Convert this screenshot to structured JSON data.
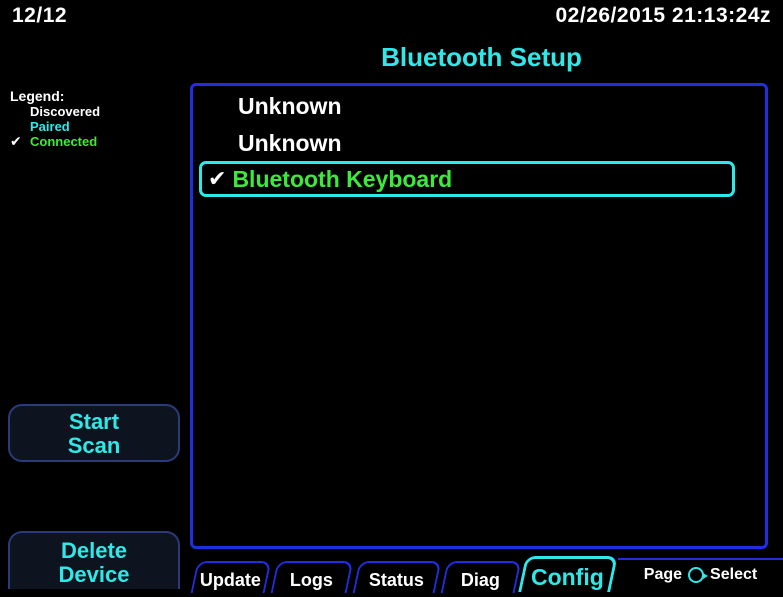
{
  "header": {
    "page_number": "12/12",
    "datetime": "02/26/2015 21:13:24z",
    "title": "Bluetooth Setup"
  },
  "legend": {
    "label": "Legend:",
    "discovered": "Discovered",
    "paired": "Paired",
    "connected": "Connected",
    "connected_mark": "✔"
  },
  "devices": [
    {
      "name": "Unknown",
      "state": "discovered"
    },
    {
      "name": "Unknown",
      "state": "discovered"
    },
    {
      "name": "Bluetooth Keyboard",
      "state": "connected",
      "mark": "✔",
      "selected": true
    }
  ],
  "softkeys": {
    "start_scan_line1": "Start",
    "start_scan_line2": "Scan",
    "delete_device_line1": "Delete",
    "delete_device_line2": "Device"
  },
  "tabs": [
    {
      "label": "Update"
    },
    {
      "label": "Logs"
    },
    {
      "label": "Status"
    },
    {
      "label": "Diag"
    },
    {
      "label": "Config",
      "active": true
    }
  ],
  "footer": {
    "page_label": "Page",
    "select_label": "Select"
  },
  "colors": {
    "title": "#2fe8e8",
    "connected": "#3bea3b",
    "panel_border": "#1f2ee0"
  }
}
